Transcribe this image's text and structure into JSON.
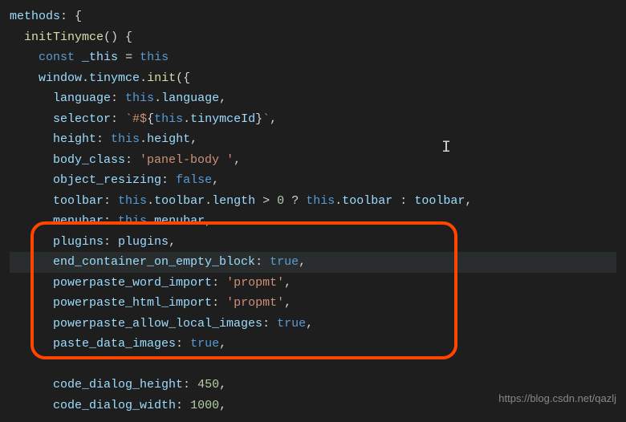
{
  "code": {
    "l1_methods": "methods",
    "l2_init": "initTinymce",
    "l3_const": "const",
    "l3_var": "_this",
    "l3_this": "this",
    "l4_window": "window",
    "l4_tinymce": "tinymce",
    "l4_init": "init",
    "l5_prop": "language",
    "l5_this": "this",
    "l5_val": "language",
    "l6_prop": "selector",
    "l6_str1": "`#$",
    "l6_this": "this",
    "l6_val": "tinymceId",
    "l6_str2": "`",
    "l7_prop": "height",
    "l7_this": "this",
    "l7_val": "height",
    "l8_prop": "body_class",
    "l8_str": "'panel-body '",
    "l9_prop": "object_resizing",
    "l9_val": "false",
    "l10_prop": "toolbar",
    "l10_this1": "this",
    "l10_val1": "toolbar",
    "l10_len": "length",
    "l10_gt": ">",
    "l10_zero": "0",
    "l10_q": "?",
    "l10_this2": "this",
    "l10_val2": "toolbar",
    "l10_colon": ":",
    "l10_val3": "toolbar",
    "l11_prop": "menubar",
    "l11_this": "this",
    "l11_val": "menubar",
    "l12_prop": "plugins",
    "l12_val": "plugins",
    "l13_prop": "end_container_on_empty_block",
    "l13_val": "true",
    "l14_prop": "powerpaste_word_import",
    "l14_str": "'propmt'",
    "l15_prop": "powerpaste_html_import",
    "l15_str": "'propmt'",
    "l16_prop": "powerpaste_allow_local_images",
    "l16_val": "true",
    "l17_prop": "paste_data_images",
    "l17_val": "true",
    "l18_prop": "code_dialog_height",
    "l18_val": "450",
    "l19_prop": "code_dialog_width",
    "l19_val": "1000"
  },
  "watermark": "https://blog.csdn.net/qazlj"
}
